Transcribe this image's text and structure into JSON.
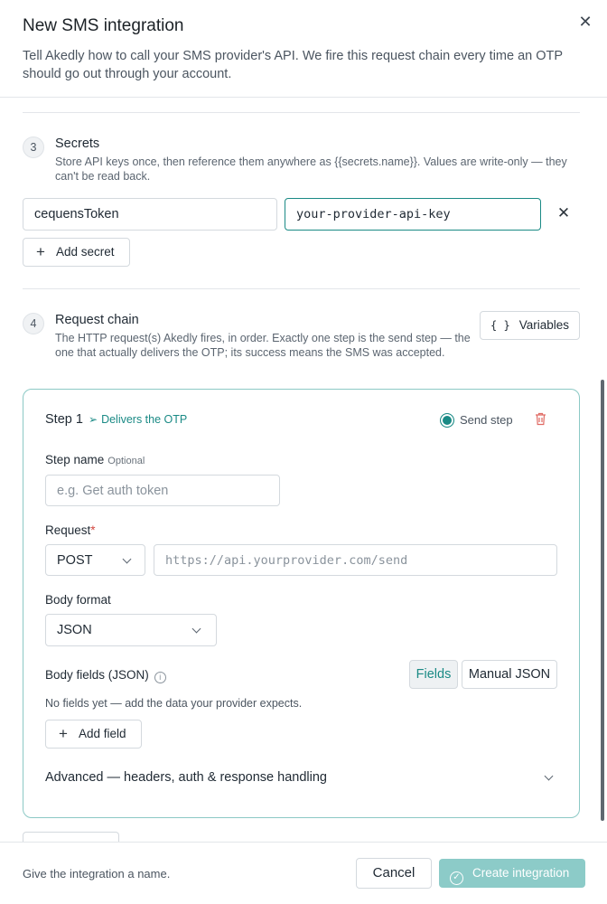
{
  "header": {
    "title": "New SMS integration",
    "subtitle": "Tell Akedly how to call your SMS provider's API. We fire this request chain every time an OTP should go out through your account.",
    "close_icon": "close-icon"
  },
  "secrets": {
    "number": "3",
    "title": "Secrets",
    "description": "Store API keys once, then reference them anywhere as {{secrets.name}}. Values are write-only — they can't be read back.",
    "rows": [
      {
        "name": "cequensToken",
        "value": "your-provider-api-key"
      }
    ],
    "add_label": "Add secret"
  },
  "request_chain": {
    "number": "4",
    "title": "Request chain",
    "description": "The HTTP request(s) Akedly fires, in order. Exactly one step is the send step — the one that actually delivers the OTP; its success means the SMS was accepted.",
    "variables_label": "Variables",
    "variables_icon": "{ }",
    "step": {
      "label": "Step 1",
      "tag": "Delivers the OTP",
      "send_step_label": "Send step",
      "send_step_checked": true,
      "name_label": "Step name",
      "name_optional": "Optional",
      "name_placeholder": "e.g. Get auth token",
      "request_label": "Request",
      "request_required": "*",
      "method": "POST",
      "url_placeholder": "https://api.yourprovider.com/send",
      "body_format_label": "Body format",
      "body_format": "JSON",
      "body_fields_label": "Body fields (JSON)",
      "mode_fields": "Fields",
      "mode_manual": "Manual JSON",
      "empty_text": "No fields yet — add the data your provider expects.",
      "add_field_label": "Add field",
      "advanced_label": "Advanced — headers, auth & response handling"
    }
  },
  "footer": {
    "hint": "Give the integration a name.",
    "cancel_label": "Cancel",
    "create_label": "Create integration"
  },
  "colors": {
    "accent": "#1a8a85",
    "accent_disabled": "#8ccbc8",
    "danger": "#e06b64"
  }
}
